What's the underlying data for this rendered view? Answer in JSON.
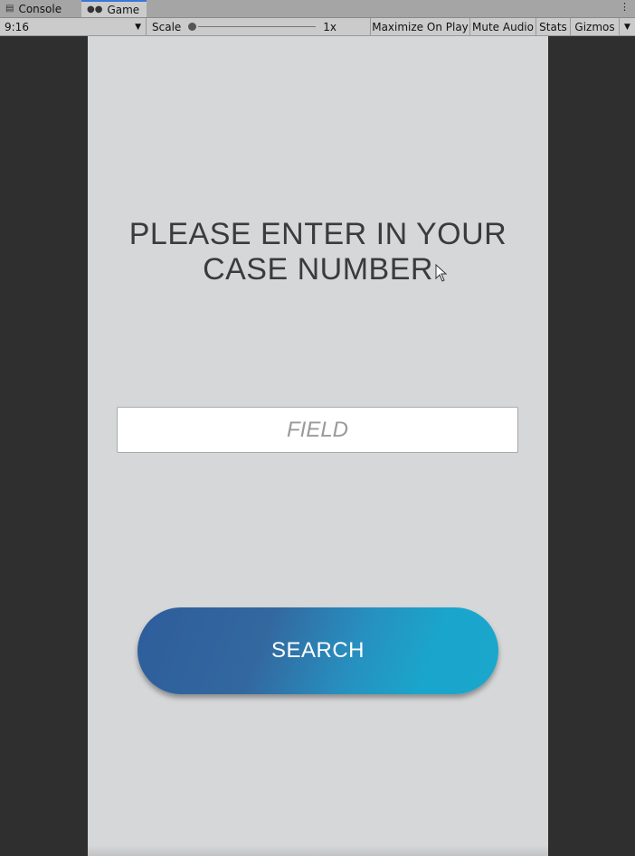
{
  "tabs": [
    {
      "label": "Console",
      "icon": "console-icon"
    },
    {
      "label": "Game",
      "icon": "gamepad-icon"
    }
  ],
  "toolbar": {
    "aspect": "9:16",
    "scale_label": "Scale",
    "scale_value": "1x",
    "maximize": "Maximize On Play",
    "mute": "Mute Audio",
    "stats": "Stats",
    "gizmos": "Gizmos"
  },
  "game": {
    "prompt_line1": "PLEASE ENTER IN YOUR",
    "prompt_line2": "CASE NUMBER",
    "field_placeholder": "FIELD",
    "search_label": "SEARCH"
  },
  "colors": {
    "canvas_bg": "#d6d7d9",
    "button_gradient_start": "#2e5d9b",
    "button_gradient_end": "#1ba6cb"
  }
}
